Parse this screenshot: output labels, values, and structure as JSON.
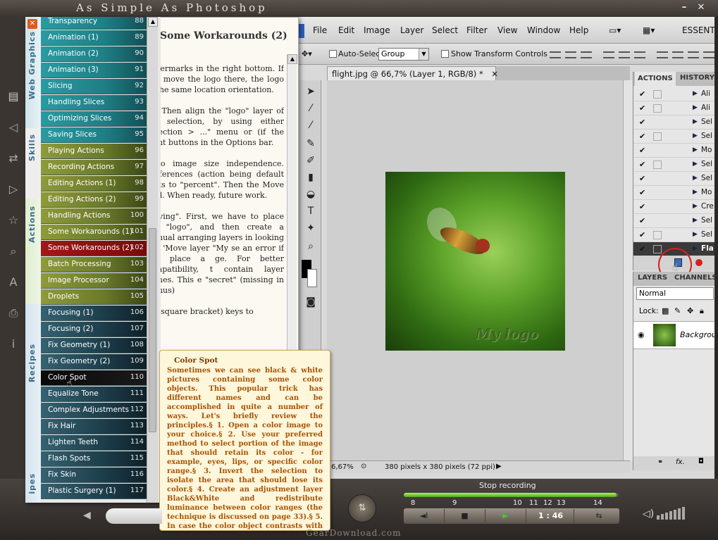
{
  "window": {
    "title": "As Simple As Photoshop",
    "minimize": "–",
    "close": "✕"
  },
  "rail_icons": [
    "book-icon",
    "back-icon",
    "share-icon",
    "play-icon",
    "star-icon",
    "search-icon",
    "font-size-icon",
    "print-icon",
    "info-icon"
  ],
  "photoshop": {
    "menus": [
      "File",
      "Edit",
      "Image",
      "Layer",
      "Select",
      "Filter",
      "View",
      "Window",
      "Help"
    ],
    "workspace": "ESSENT",
    "options": {
      "auto_select_label": "Auto-Select:",
      "auto_select_value": "Group",
      "transform_label": "Show Transform Controls"
    },
    "doc_tab": "flight.jpg @ 66,7% (Layer 1, RGB/8) *",
    "doc_tab_close": "✕",
    "photo_logo": "My logo",
    "status": {
      "zoom": "6,67%",
      "info": "380 pixels x 380 pixels (72 ppi)"
    },
    "actions_panel": {
      "tabs": [
        "ACTIONS",
        "HISTORY"
      ],
      "rows": [
        {
          "label": "Ali",
          "checked": true,
          "box": true
        },
        {
          "label": "Ali",
          "checked": true,
          "box": true
        },
        {
          "label": "Sel",
          "checked": true,
          "box": false
        },
        {
          "label": "Sel",
          "checked": true,
          "box": true
        },
        {
          "label": "Mo",
          "checked": true,
          "box": false
        },
        {
          "label": "Sel",
          "checked": true,
          "box": true
        },
        {
          "label": "Sel",
          "checked": true,
          "box": false
        },
        {
          "label": "Mo",
          "checked": true,
          "box": false
        },
        {
          "label": "Cre",
          "checked": true,
          "box": false
        },
        {
          "label": "Sel",
          "checked": true,
          "box": false
        },
        {
          "label": "Sel",
          "checked": true,
          "box": true
        },
        {
          "label": "Fla",
          "checked": true,
          "box": true
        }
      ]
    },
    "layers_panel": {
      "tabs": [
        "LAYERS",
        "CHANNELS"
      ],
      "blend_mode": "Normal",
      "lock_label": "Lock:",
      "layer_name": "Backgrou",
      "bottom_icons": "fx."
    }
  },
  "book": {
    "heading": "Some Workarounds (2)",
    "paragraphs": [
      "watermarks in the right bottom. If you move the logo there, the logo to the same location orientation.",
      "all. Then align the \"logo\" layer of the selection, by using either Selection > ...\" menu or (if the ment buttons in the Options bar.",
      "y to image size independence. preferences (action being default units to \"percent\". Then the Move Tool. When ready, future work.",
      "carving\". First, we have to place the \"logo\", and then create a manual arranging layers in looking like 'Move layer \"My se an error if you place a ge. For better compatibility, t contain layer names. This e \"secret\" (missing in menus)",
      "ing square bracket) keys to"
    ]
  },
  "menu": {
    "close": "✕",
    "categories": [
      "Web Graphics",
      "Skills",
      "Actions",
      "Recipes",
      "ipes"
    ],
    "items": [
      {
        "label": "Transparency",
        "page": "88"
      },
      {
        "label": "Animation (1)",
        "page": "89"
      },
      {
        "label": "Animation (2)",
        "page": "90"
      },
      {
        "label": "Animation (3)",
        "page": "91"
      },
      {
        "label": "Slicing",
        "page": "92"
      },
      {
        "label": "Handling Slices",
        "page": "93"
      },
      {
        "label": "Optimizing Slices",
        "page": "94"
      },
      {
        "label": "Saving Slices",
        "page": "95"
      },
      {
        "label": "Playing Actions",
        "page": "96"
      },
      {
        "label": "Recording Actions",
        "page": "97"
      },
      {
        "label": "Editing Actions (1)",
        "page": "98"
      },
      {
        "label": "Editing Actions (2)",
        "page": "99"
      },
      {
        "label": "Handling Actions",
        "page": "100"
      },
      {
        "label": "Some Workarounds (1)",
        "page": "101"
      },
      {
        "label": "Some Workarounds (2)",
        "page": "102"
      },
      {
        "label": "Batch Processing",
        "page": "103"
      },
      {
        "label": "Image Processor",
        "page": "104"
      },
      {
        "label": "Droplets",
        "page": "105"
      },
      {
        "label": "Focusing (1)",
        "page": "106"
      },
      {
        "label": "Focusing (2)",
        "page": "107"
      },
      {
        "label": "Fix Geometry (1)",
        "page": "108"
      },
      {
        "label": "Fix Geometry (2)",
        "page": "109"
      },
      {
        "label": "Color Spot",
        "page": "110"
      },
      {
        "label": "Equalize Tone",
        "page": "111"
      },
      {
        "label": "Complex Adjustments",
        "page": "112"
      },
      {
        "label": "Fix Hair",
        "page": "113"
      },
      {
        "label": "Lighten Teeth",
        "page": "114"
      },
      {
        "label": "Flash Spots",
        "page": "115"
      },
      {
        "label": "Fix Skin",
        "page": "116"
      },
      {
        "label": "Plastic Surgery (1)",
        "page": "117"
      }
    ],
    "active_index": 14,
    "hover_index": 22
  },
  "tooltip": {
    "title": "Color Spot",
    "body": "Sometimes we can see black & white pictures containing some color objects. This popular trick has different names and can be accomplished in quite a number of ways. Let's briefly review the principles.§ 1. Open a color image to your choice.§ 2. Use your preferred method to select portion of the image that should retain its color - for example, eyes, lips, or specific color range.§ 3. Invert the selection to isolate the area that should lose its color.§ 4. Create an adjustment layer Black&White and redistribute luminance between color ranges (the technique is discussed on page 33).§ 5. In case the color object contrasts with black & white environment much too strongly, blur the mask of the adjustment"
  },
  "player": {
    "status": "Stop recording",
    "progress": 0.99,
    "ticks": [
      "8",
      "9",
      "10",
      "11",
      "12",
      "13",
      "14"
    ],
    "buttons": {
      "prev": "◄I",
      "stop": "■",
      "play": "►",
      "loop": "⇆"
    },
    "time": "1 : 46",
    "round_button": "⇅"
  },
  "footer": {
    "watermark": "GearDownload.com"
  },
  "colors": {
    "menu_web": "#1f7f86",
    "menu_actions": "#6b7a2a",
    "menu_recipes": "#1d3d4a",
    "menu_active": "#7a0a0a",
    "record_red": "#d42020"
  }
}
